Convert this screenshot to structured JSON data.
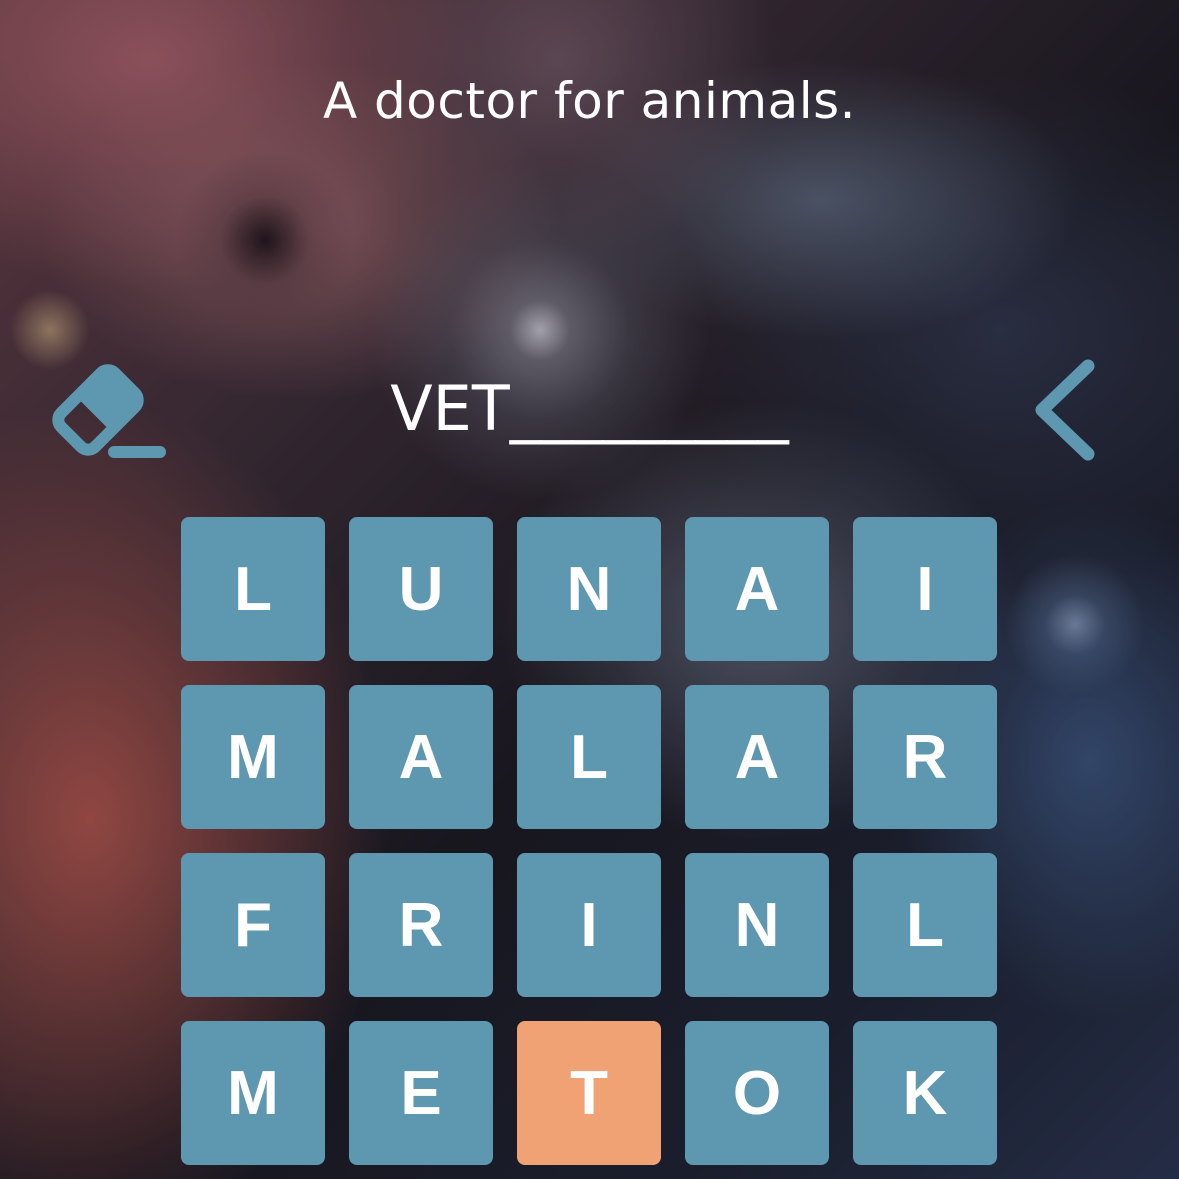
{
  "clue": "A doctor for animals.",
  "answer": "VET_________",
  "icons": {
    "eraser": "eraser-icon",
    "back": "chevron-left-icon"
  },
  "colors": {
    "tile": "#5e97b0",
    "tile_selected": "#f0a275",
    "icon": "#5e97b0",
    "text": "#ffffff"
  },
  "grid": {
    "rows": [
      [
        {
          "letter": "L",
          "selected": false
        },
        {
          "letter": "U",
          "selected": false
        },
        {
          "letter": "N",
          "selected": false
        },
        {
          "letter": "A",
          "selected": false
        },
        {
          "letter": "I",
          "selected": false
        }
      ],
      [
        {
          "letter": "M",
          "selected": false
        },
        {
          "letter": "A",
          "selected": false
        },
        {
          "letter": "L",
          "selected": false
        },
        {
          "letter": "A",
          "selected": false
        },
        {
          "letter": "R",
          "selected": false
        }
      ],
      [
        {
          "letter": "F",
          "selected": false
        },
        {
          "letter": "R",
          "selected": false
        },
        {
          "letter": "I",
          "selected": false
        },
        {
          "letter": "N",
          "selected": false
        },
        {
          "letter": "L",
          "selected": false
        }
      ],
      [
        {
          "letter": "M",
          "selected": false
        },
        {
          "letter": "E",
          "selected": false
        },
        {
          "letter": "T",
          "selected": true
        },
        {
          "letter": "O",
          "selected": false
        },
        {
          "letter": "K",
          "selected": false
        }
      ]
    ]
  }
}
